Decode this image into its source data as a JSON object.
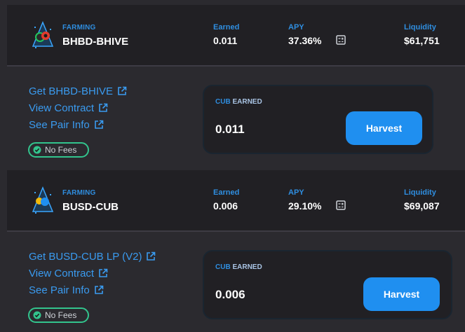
{
  "farms": [
    {
      "tag": "FARMING",
      "pair": "BHBD-BHIVE",
      "earned_label": "Earned",
      "earned_value": "0.011",
      "apy_label": "APY",
      "apy_value": "37.36%",
      "liquidity_label": "Liquidity",
      "liquidity_value": "$61,751",
      "links": [
        "Get BHBD-BHIVE",
        "View Contract",
        "See Pair Info"
      ],
      "no_fees": "No Fees",
      "earn_title_token": "CUB",
      "earn_title_word": "EARNED",
      "earn_amount": "0.011",
      "harvest_label": "Harvest"
    },
    {
      "tag": "FARMING",
      "pair": "BUSD-CUB",
      "earned_label": "Earned",
      "earned_value": "0.006",
      "apy_label": "APY",
      "apy_value": "29.10%",
      "liquidity_label": "Liquidity",
      "liquidity_value": "$69,087",
      "links": [
        "Get BUSD-CUB LP (V2)",
        "View Contract",
        "See Pair Info"
      ],
      "no_fees": "No Fees",
      "earn_title_token": "CUB",
      "earn_title_word": "EARNED",
      "earn_amount": "0.006",
      "harvest_label": "Harvest"
    }
  ],
  "colors": {
    "accent_blue": "#2f8ee0",
    "link_blue": "#3a9bf0",
    "button_blue": "#1f8ff0",
    "no_fees_green": "#32c48d",
    "header_bg": "#212024",
    "page_bg": "#2b2a2f"
  },
  "icons": {
    "token": "pair-token-icon",
    "calculator": "calculator-icon",
    "external": "external-link-icon",
    "check": "check-badge-icon"
  }
}
